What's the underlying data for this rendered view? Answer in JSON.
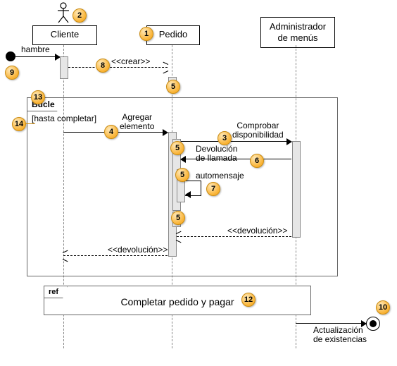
{
  "actors": {
    "cliente": "Cliente",
    "pedido": "Pedido",
    "admin": "Administrador\nde menús"
  },
  "messages": {
    "found": "hambre",
    "create": "<<crear>>",
    "add": "Agregar\nelemento",
    "check": "Comprobar\ndisponibilidad",
    "callback": "Devolución\nde llamada",
    "selfmsg": "automensaje",
    "return": "<<devolución>>",
    "return2": "<<devolución>>",
    "update": "Actualización\nde existencias"
  },
  "frames": {
    "loop": "Bucle",
    "loop_guard": "[hasta completar]",
    "ref_tag": "ref",
    "ref_label": "Completar pedido y pagar"
  },
  "nums": {
    "1": "1",
    "2": "2",
    "3": "3",
    "4": "4",
    "5": "5",
    "6": "6",
    "7": "7",
    "8": "8",
    "9": "9",
    "10": "10",
    "12": "12",
    "13": "13",
    "14": "14"
  }
}
